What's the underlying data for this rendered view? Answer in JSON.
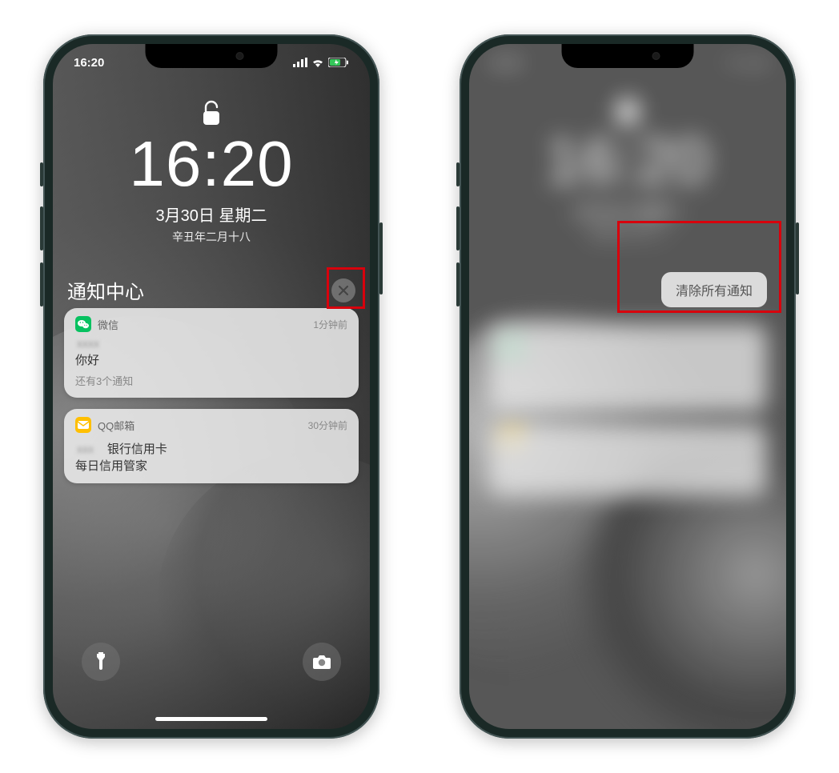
{
  "status": {
    "time": "16:20"
  },
  "lock": {
    "time": "16:20",
    "date": "3月30日 星期二",
    "subdate": "辛丑年二月十八"
  },
  "notification_center": {
    "title": "通知中心"
  },
  "clear_all": {
    "label": "清除所有通知"
  },
  "notifications": [
    {
      "app": "微信",
      "time": "1分钟前",
      "sender": "xxxx",
      "message": "你好",
      "more": "还有3个通知"
    },
    {
      "app": "QQ邮箱",
      "time": "30分钟前",
      "line1": "银行信用卡",
      "line2": "每日信用管家"
    }
  ]
}
